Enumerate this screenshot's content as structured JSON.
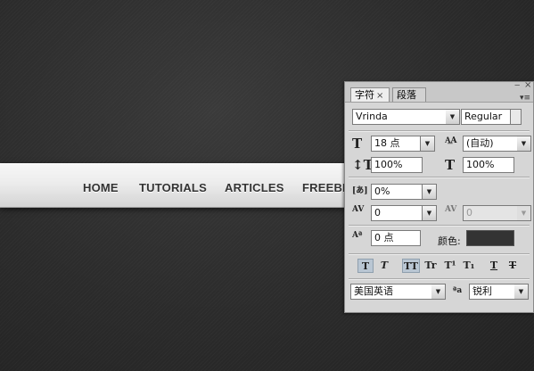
{
  "nav": {
    "items": [
      "HOME",
      "TUTORIALS",
      "ARTICLES",
      "FREEBI"
    ]
  },
  "panel": {
    "tabs": [
      {
        "label": "字符",
        "active": true
      },
      {
        "label": "段落",
        "active": false
      }
    ],
    "tab_close_glyph": "×",
    "minimize_glyph": "‒",
    "close_glyph": "×",
    "menu_glyph": "▾≡",
    "font_family": "Vrinda",
    "font_style": "Regular",
    "font_size": "18 点",
    "leading": "(自动)",
    "vertical_scale": "100%",
    "horizontal_scale": "100%",
    "tsume": "0%",
    "kerning": "0",
    "tracking": "0",
    "baseline_shift": "0 点",
    "color_label": "颜色:",
    "color_value": "#333333",
    "language": "美国英语",
    "antialias_icon": "ªa",
    "antialias": "锐利",
    "dropdown_glyph": "▼",
    "style_buttons": [
      {
        "glyph": "T",
        "name": "faux-bold-button",
        "pressed": true
      },
      {
        "glyph": "T",
        "name": "faux-italic-button",
        "pressed": false
      },
      {
        "glyph": "TT",
        "name": "all-caps-button",
        "pressed": true
      },
      {
        "glyph": "Tr",
        "name": "small-caps-button",
        "pressed": false
      },
      {
        "glyph": "T¹",
        "name": "superscript-button",
        "pressed": false
      },
      {
        "glyph": "T₁",
        "name": "subscript-button",
        "pressed": false
      },
      {
        "glyph": "T",
        "name": "underline-button",
        "pressed": false
      },
      {
        "glyph": "T",
        "name": "strikethrough-button",
        "pressed": false
      }
    ]
  }
}
